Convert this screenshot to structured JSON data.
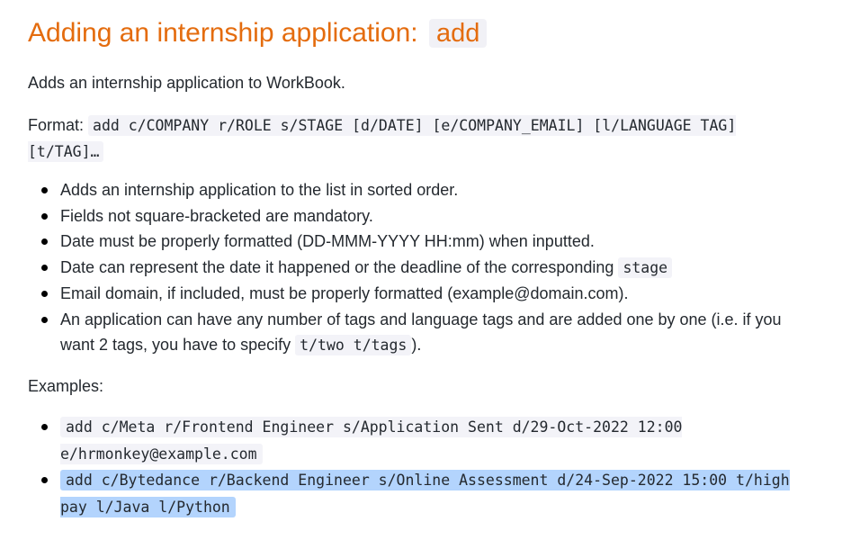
{
  "heading": {
    "text": "Adding an internship application: ",
    "code": "add"
  },
  "intro": "Adds an internship application to WorkBook.",
  "format": {
    "label": "Format: ",
    "code": "add c/COMPANY r/ROLE s/STAGE [d/DATE] [e/COMPANY_EMAIL] [l/LANGUAGE TAG] [t/TAG]…"
  },
  "rules": [
    {
      "text": "Adds an internship application to the list in sorted order."
    },
    {
      "text": "Fields not square-bracketed are mandatory."
    },
    {
      "text": "Date must be properly formatted (DD-MMM-YYYY HH:mm) when inputted."
    },
    {
      "text": "Date can represent the date it happened or the deadline of the corresponding ",
      "code": "stage"
    },
    {
      "text": "Email domain, if included, must be properly formatted (example@domain.com)."
    },
    {
      "text": "An application can have any number of tags and language tags and are added one by one (i.e. if you want 2 tags, you have to specify ",
      "code": "t/two t/tags",
      "after": ")."
    }
  ],
  "examples_label": "Examples:",
  "examples": [
    {
      "code": "add c/Meta r/Frontend Engineer s/Application Sent d/29-Oct-2022 12:00 e/hrmonkey@example.com"
    },
    {
      "code": "add c/Bytedance r/Backend Engineer s/Online Assessment d/24-Sep-2022 15:00 t/high pay l/Java l/Python"
    }
  ],
  "colors": {
    "heading": "#e46c0e",
    "code_bg": "#f3f3f8",
    "selection": "#b3d4fd"
  }
}
